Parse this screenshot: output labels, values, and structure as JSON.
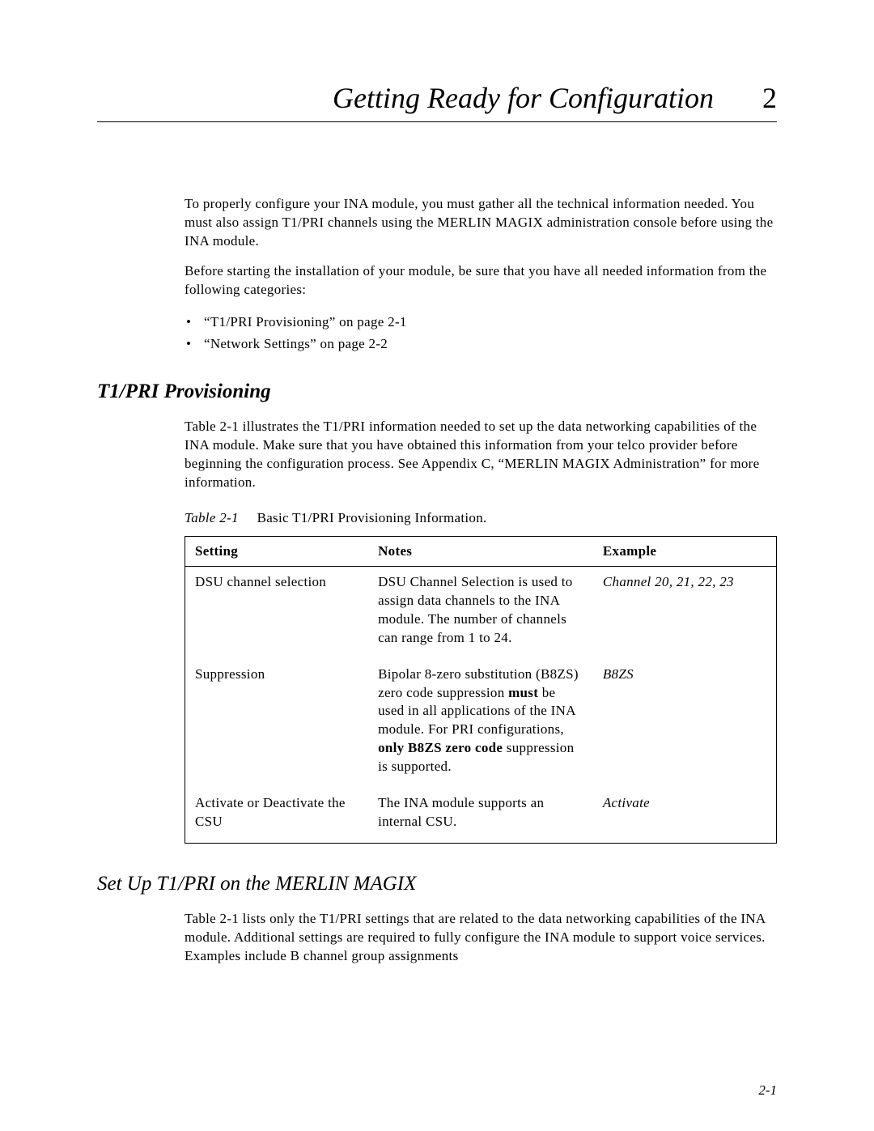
{
  "chapter": {
    "title": "Getting Ready for Configuration",
    "number": "2"
  },
  "intro": {
    "p1": "To properly configure your INA module, you must gather all the technical information needed. You must also assign T1/PRI channels using the MERLIN MAGIX administration console before using the INA module.",
    "p2": "Before starting the installation of your module, be sure that you have all needed information from the following categories:",
    "bullets": [
      "“T1/PRI Provisioning” on page 2-1",
      "“Network Settings” on page 2-2"
    ]
  },
  "section1": {
    "heading": "T1/PRI Provisioning",
    "p1": "Table 2-1 illustrates the T1/PRI information needed to set up the data networking capabilities of the INA module. Make sure that you have obtained this information from your telco provider before beginning the configuration process. See Appendix C, “MERLIN MAGIX Administration” for more information.",
    "tableCaptionLabel": "Table 2-1",
    "tableCaptionText": "Basic T1/PRI Provisioning Information.",
    "tableHeaders": {
      "setting": "Setting",
      "notes": "Notes",
      "example": "Example"
    },
    "rows": [
      {
        "setting": "DSU channel selection",
        "notes_plain": "DSU Channel Selection is used to assign data channels to the INA module. The number of channels can range from 1 to 24.",
        "example": "Channel 20, 21, 22, 23"
      },
      {
        "setting": "Suppression",
        "notes_parts": {
          "a": "Bipolar 8-zero substitution (B8ZS) zero code suppression ",
          "b": "must",
          "c": " be used in all applications of the INA module. For PRI configurations, ",
          "d": "only B8ZS zero code",
          "e": " suppression is supported."
        },
        "example": "B8ZS"
      },
      {
        "setting": "Activate or Deactivate the CSU",
        "notes_plain": "The INA module supports an internal CSU.",
        "example": "Activate"
      }
    ]
  },
  "section2": {
    "heading": "Set Up T1/PRI on the MERLIN MAGIX",
    "p1": "Table 2-1 lists only the T1/PRI settings that are related to the data networking capabilities of the INA module. Additional settings are required to fully configure the INA module to support voice services. Examples include B channel group assignments"
  },
  "pageNumber": "2-1"
}
